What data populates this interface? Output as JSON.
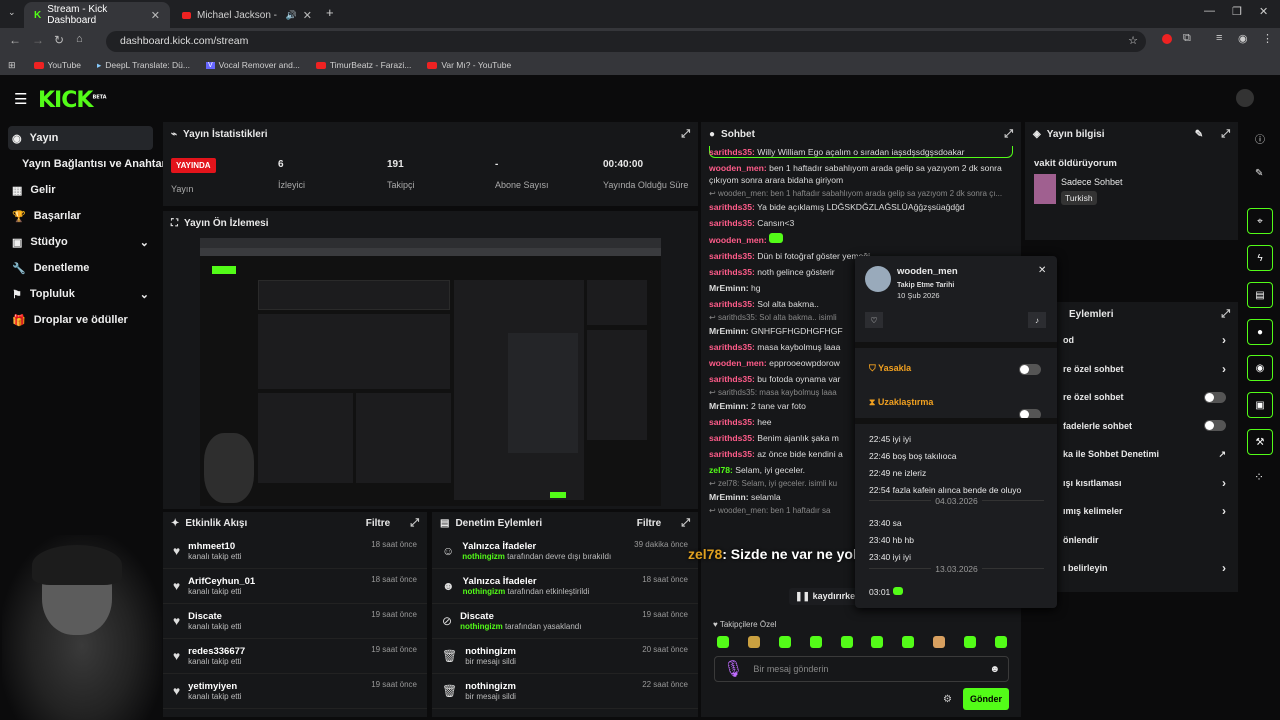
{
  "browser": {
    "tabs": [
      {
        "title": "Stream - Kick Dashboard"
      },
      {
        "title": "Michael Jackson - Billie Jea"
      }
    ],
    "url": "dashboard.kick.com/stream",
    "bookmarks": [
      {
        "label": "YouTube"
      },
      {
        "label": "DeepL Translate: Dü..."
      },
      {
        "label": "Vocal Remover and..."
      },
      {
        "label": "TimurBeatz - Farazi..."
      },
      {
        "label": "Var Mı? - YouTube"
      }
    ]
  },
  "app": {
    "logo": "KICK",
    "beta": "BETA"
  },
  "sidebar": {
    "items": [
      {
        "label": "Yayın"
      },
      {
        "label": "Yayın Bağlantısı ve Anahtarı"
      },
      {
        "label": "Gelir"
      },
      {
        "label": "Başarılar"
      },
      {
        "label": "Stüdyo"
      },
      {
        "label": "Denetleme"
      },
      {
        "label": "Topluluk"
      },
      {
        "label": "Droplar ve ödüller"
      }
    ]
  },
  "stats": {
    "title": "Yayın İstatistikleri",
    "live_badge": "YAYINDA",
    "live_label": "Yayın",
    "viewers_value": "6",
    "viewers_label": "İzleyici",
    "followers_value": "191",
    "followers_label": "Takipçi",
    "subs_value": "-",
    "subs_label": "Abone Sayısı",
    "uptime_value": "00:40:00",
    "uptime_label": "Yayında Olduğu Süre"
  },
  "preview": {
    "title": "Yayın Ön İzlemesi"
  },
  "activity": {
    "title": "Etkinlik Akışı",
    "filter": "Filtre",
    "items": [
      {
        "name": "mhmeet10",
        "sub": "kanalı takip etti",
        "time": "18 saat önce"
      },
      {
        "name": "ArifCeyhun_01",
        "sub": "kanalı takip etti",
        "time": "18 saat önce"
      },
      {
        "name": "Discate",
        "sub": "kanalı takip etti",
        "time": "19 saat önce"
      },
      {
        "name": "redes336677",
        "sub": "kanalı takip etti",
        "time": "19 saat önce"
      },
      {
        "name": "yetimyiyen",
        "sub": "kanalı takip etti",
        "time": "19 saat önce"
      }
    ]
  },
  "modactions": {
    "title": "Denetim Eylemleri",
    "filter": "Filtre",
    "items": [
      {
        "name": "Yalnızca İfadeler",
        "actor": "nothingizm",
        "sub": "tarafından devre dışı bırakıldı",
        "time": "39 dakika önce"
      },
      {
        "name": "Yalnızca İfadeler",
        "actor": "nothingizm",
        "sub": "tarafından etkinleştirildi",
        "time": "18 saat önce"
      },
      {
        "name": "Discate",
        "actor": "nothingizm",
        "sub": "tarafından yasaklandı",
        "time": "19 saat önce"
      },
      {
        "name": "nothingizm",
        "actor": "",
        "sub": "bir mesajı sildi",
        "time": "20 saat önce"
      },
      {
        "name": "nothingizm",
        "actor": "",
        "sub": "bir mesajı sildi",
        "time": "22 saat önce"
      }
    ]
  },
  "chat": {
    "title": "Sohbet",
    "messages": [
      {
        "user": "sarithds35:",
        "text": "Willy William Ego açalım o sıradan iaşsdşsdgşsdoakar",
        "color": "pink"
      },
      {
        "user": "wooden_men:",
        "text": "ben 1 haftadır sabahlıyom arada gelip sa yazıyom 2 dk sonra çıkıyom sonra arara bidaha giriyom",
        "color": "pink"
      },
      {
        "reply": "wooden_men: ben 1 haftadır sabahlıyom arada gelip sa yazıyom 2 dk sonra çı..."
      },
      {
        "user": "sarithds35:",
        "text": "Ya bide açıklamış LDĞSKDĞZLAĞSLÜAğğzşsüağdğd",
        "color": "pink"
      },
      {
        "user": "sarithds35:",
        "text": "Cansın<3",
        "color": "pink"
      },
      {
        "user": "wooden_men:",
        "text": "",
        "color": "pink"
      },
      {
        "user": "sarithds35:",
        "text": "Dün bi fotoğraf göster yemeği",
        "color": "pink"
      },
      {
        "user": "sarithds35:",
        "text": "noth gelince gösterir",
        "color": "pink"
      },
      {
        "user": "MrEminn:",
        "text": "hg",
        "color": "white"
      },
      {
        "user": "sarithds35:",
        "text": "Sol alta bakma..",
        "color": "pink"
      },
      {
        "reply": "sarithds35: Sol alta bakma.. isimli"
      },
      {
        "user": "MrEminn:",
        "text": "GNHFGFHGDHGFHGF",
        "color": "white"
      },
      {
        "user": "sarithds35:",
        "text": "masa kaybolmuş laaa",
        "color": "pink"
      },
      {
        "user": "wooden_men:",
        "text": "epprooeowpdorow",
        "color": "pink"
      },
      {
        "user": "sarithds35:",
        "text": "bu fotoda oynama var",
        "color": "pink"
      },
      {
        "reply": "sarithds35: masa kaybolmuş laaa"
      },
      {
        "user": "MrEminn:",
        "text": "2 tane var foto",
        "color": "white"
      },
      {
        "user": "sarithds35:",
        "text": "hee",
        "color": "pink"
      },
      {
        "user": "sarithds35:",
        "text": "Benim ajanlık şaka m",
        "color": "pink"
      },
      {
        "user": "sarithds35:",
        "text": "az önce bide kendini a",
        "color": "pink"
      },
      {
        "user": "zel78:",
        "text": "Selam, iyi geceler.",
        "color": "green"
      },
      {
        "reply": "zel78: Selam, iyi geceler. isimli ku"
      },
      {
        "user": "MrEminn:",
        "text": "selamla",
        "color": "white"
      },
      {
        "reply": "wooden_men: ben 1 haftadır sa"
      }
    ],
    "pause_label": "kaydırırke",
    "followers_only": "Takipçilere Özel",
    "input_placeholder": "Bir mesaj gönderin",
    "send": "Gönder",
    "overlay_user": "zel78",
    "overlay_text": ": Sizde ne var ne yok?"
  },
  "usercard": {
    "username": "wooden_men",
    "follow_label": "Takip Etme Tarihi",
    "follow_date": "10 Şub 2026",
    "ban": "Yasakla",
    "timeout": "Uzaklaştırma",
    "history": [
      {
        "time": "22:45",
        "text": "iyi iyi"
      },
      {
        "time": "22:46",
        "text": "boş boş takılıoca"
      },
      {
        "time": "22:49",
        "text": "ne izleriz"
      },
      {
        "time": "22:54",
        "text": "fazla kafein alınca bende de oluyo"
      }
    ],
    "date1": "04.03.2026",
    "history2": [
      {
        "time": "23:40",
        "text": "sa"
      },
      {
        "time": "23:40",
        "text": "hb hb"
      },
      {
        "time": "23:40",
        "text": "iyi iyi"
      }
    ],
    "date2": "13.03.2026",
    "history3_time": "03:01"
  },
  "streaminfo": {
    "title": "Yayın bilgisi",
    "stream_title": "vakit öldürüyorum",
    "category": "Sadece Sohbet",
    "tag": "Turkish"
  },
  "chatactions": {
    "title": "Eylemleri",
    "items": [
      {
        "label": "od",
        "control": "arrow"
      },
      {
        "label": "re özel sohbet",
        "control": "arrow"
      },
      {
        "label": "re özel sohbet",
        "control": "toggle"
      },
      {
        "label": "fadelerle sohbet",
        "control": "toggle"
      },
      {
        "label": "ka ile Sohbet Denetimi",
        "control": "ext"
      },
      {
        "label": "ışı kısıtlaması",
        "control": "arrow"
      },
      {
        "label": "ımış kelimeler",
        "control": "arrow"
      },
      {
        "label": "önlendir",
        "control": ""
      },
      {
        "label": "ı belirleyin",
        "control": "arrow"
      }
    ]
  },
  "colors": {
    "accent": "#53fc18",
    "live": "#e3141b",
    "pink": "#ff5c8a",
    "panel": "#161719"
  }
}
